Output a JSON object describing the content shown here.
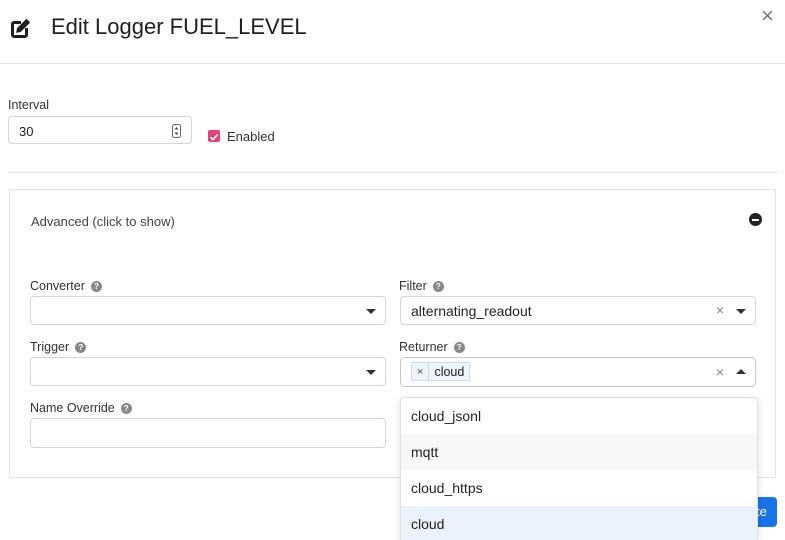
{
  "modal": {
    "title": "Edit Logger FUEL_LEVEL",
    "title_icon": "edit-icon",
    "close_label": "×"
  },
  "interval": {
    "label": "Interval",
    "value": "30"
  },
  "enabled": {
    "label": "Enabled",
    "checked": true,
    "color": "#e0457b"
  },
  "advanced": {
    "label": "Advanced (click to show)",
    "expanded": true
  },
  "converter": {
    "label": "Converter",
    "help": "?",
    "value": ""
  },
  "filter": {
    "label": "Filter",
    "help": "?",
    "value": "alternating_readout",
    "clear": "×"
  },
  "trigger": {
    "label": "Trigger",
    "help": "?",
    "value": ""
  },
  "returner": {
    "label": "Returner",
    "help": "?",
    "selected_tags": [
      {
        "remove": "×",
        "text": "cloud"
      }
    ],
    "clear": "×",
    "open": true,
    "options": [
      "cloud_jsonl",
      "mqtt",
      "cloud_https",
      "cloud"
    ],
    "hovered_option": "mqtt",
    "selected_option": "cloud"
  },
  "name_override": {
    "label": "Name Override",
    "help": "?",
    "value": ""
  },
  "update_button": {
    "label": "te",
    "color": "#1a73e8"
  }
}
